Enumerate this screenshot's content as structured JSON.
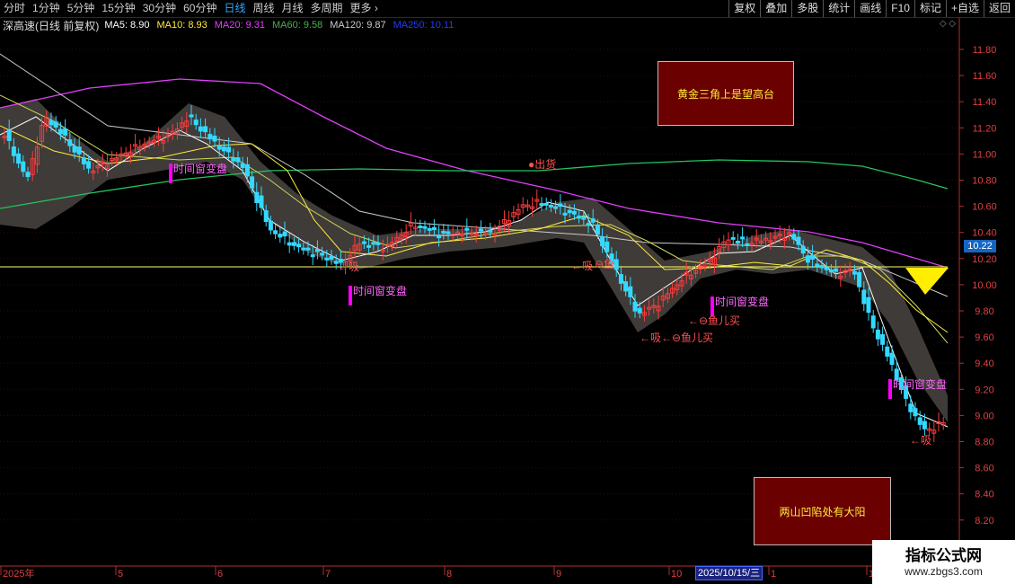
{
  "toolbar": {
    "periods": [
      "分时",
      "1分钟",
      "5分钟",
      "15分钟",
      "30分钟",
      "60分钟",
      "日线",
      "周线",
      "月线",
      "多周期",
      "更多 ›"
    ],
    "active_period": "日线",
    "tools": [
      "复权",
      "叠加",
      "多股",
      "统计",
      "画线",
      "F10",
      "标记",
      "+自选",
      "返回"
    ]
  },
  "stock": {
    "title": "深高速(日线 前复权)"
  },
  "moving_averages": [
    {
      "label": "MA5: 8.90",
      "color": "#ffffff"
    },
    {
      "label": "MA10: 8.93",
      "color": "#ffeb3b"
    },
    {
      "label": "MA20: 9.31",
      "color": "#e040fb"
    },
    {
      "label": "MA60: 9.58",
      "color": "#4caf50"
    },
    {
      "label": "MA120: 9.87",
      "color": "#cccccc"
    },
    {
      "label": "MA250: 10.11",
      "color": "#1e3cff"
    }
  ],
  "info_icons": "◇ ◇",
  "current_price": "10.22",
  "price_axis": [
    "11.80",
    "11.60",
    "11.40",
    "11.20",
    "11.00",
    "10.80",
    "10.60",
    "10.40",
    "10.20",
    "10.00",
    "9.80",
    "9.60",
    "9.40",
    "9.20",
    "9.00",
    "8.80",
    "8.60",
    "8.40",
    "8.20"
  ],
  "date_axis": [
    "2025年",
    "5",
    "6",
    "7",
    "8",
    "9",
    "10",
    "1",
    "1"
  ],
  "cursor_date": "2025/10/15/三",
  "notes": {
    "top": "黄金三角上是望高台",
    "bottom": "两山凹陷处有大阳"
  },
  "signals": [
    {
      "text": "时间窗变盘",
      "color": "#ff66ff"
    },
    {
      "text": "←吸",
      "color": "#ff5050"
    },
    {
      "text": "时间窗变盘",
      "color": "#ff66ff"
    },
    {
      "text": "←吸",
      "color": "#ff5050"
    },
    {
      "text": "●出货",
      "color": "#ff5050"
    },
    {
      "text": "←⊖鱼",
      "color": "#ff5050"
    },
    {
      "text": "时间窗变盘",
      "color": "#ff66ff"
    },
    {
      "text": "←⊖鱼儿买",
      "color": "#ff5050"
    },
    {
      "text": "←吸←⊖鱼儿买",
      "color": "#ff5050"
    },
    {
      "text": "时间窗变盘",
      "color": "#ff66ff"
    },
    {
      "text": "←吸",
      "color": "#ff5050"
    }
  ],
  "watermark": {
    "line1": "指标公式网",
    "line2": "www.zbgs3.com"
  },
  "colors": {
    "up": "#ff3b3b",
    "down": "#33d9ff",
    "axis": "#b0312d",
    "hline": "#ffff66",
    "band": "#4a4542"
  }
}
